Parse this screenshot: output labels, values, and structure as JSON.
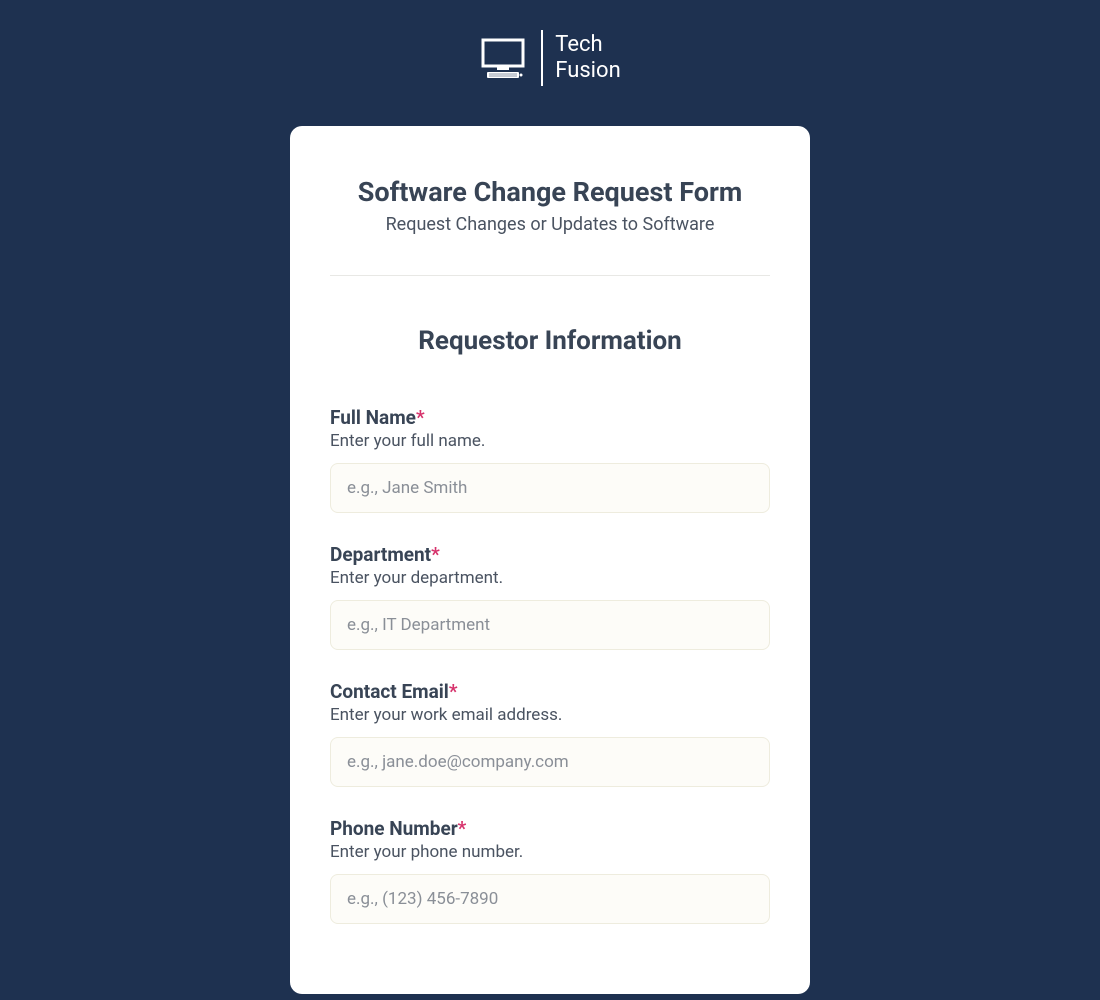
{
  "logo": {
    "line1": "Tech",
    "line2": "Fusion"
  },
  "form": {
    "title": "Software Change Request Form",
    "subtitle": "Request Changes or Updates to Software"
  },
  "section": {
    "title": "Requestor Information"
  },
  "fields": {
    "fullName": {
      "label": "Full Name",
      "hint": "Enter your full name.",
      "placeholder": "e.g., Jane Smith",
      "value": ""
    },
    "department": {
      "label": "Department",
      "hint": "Enter your department.",
      "placeholder": "e.g., IT Department",
      "value": ""
    },
    "email": {
      "label": "Contact Email",
      "hint": "Enter your work email address.",
      "placeholder": "e.g., jane.doe@company.com",
      "value": ""
    },
    "phone": {
      "label": "Phone Number",
      "hint": "Enter your phone number.",
      "placeholder": "e.g., (123) 456-7890",
      "value": ""
    }
  },
  "requiredMark": "*"
}
